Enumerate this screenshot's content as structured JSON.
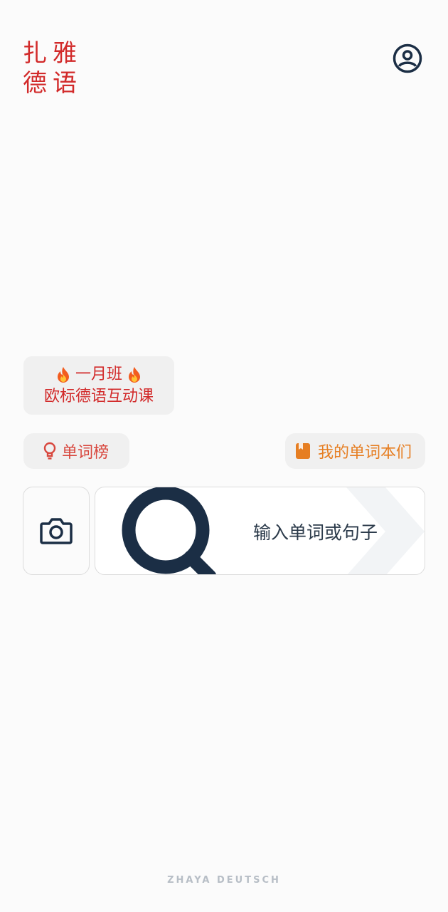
{
  "logo": {
    "chars": [
      "扎",
      "雅",
      "德",
      "语"
    ]
  },
  "header": {
    "profile_icon": "user-circle-icon"
  },
  "promo": {
    "line1": "一月班",
    "line2": "欧标德语互动课",
    "icon": "flame-icon"
  },
  "chips": {
    "rank_label": "单词榜",
    "rank_icon": "lightbulb-icon",
    "notebook_label": "我的单词本们",
    "notebook_icon": "book-icon"
  },
  "search": {
    "camera_icon": "camera-icon",
    "search_icon": "magnifier-icon",
    "placeholder": "输入单词或句子"
  },
  "footer": {
    "text": "ZHAYA DEUTSCH"
  },
  "colors": {
    "brand_red": "#d22a2a",
    "accent_orange": "#e67e22",
    "icon_navy": "#1b2e45",
    "background": "#fbfbfb"
  }
}
